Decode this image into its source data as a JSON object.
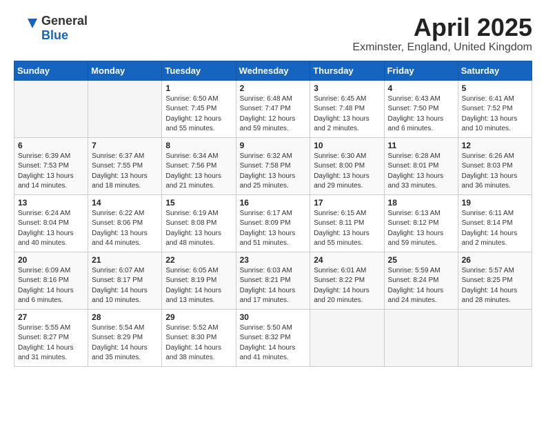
{
  "logo": {
    "general": "General",
    "blue": "Blue"
  },
  "title": "April 2025",
  "subtitle": "Exminster, England, United Kingdom",
  "days_of_week": [
    "Sunday",
    "Monday",
    "Tuesday",
    "Wednesday",
    "Thursday",
    "Friday",
    "Saturday"
  ],
  "weeks": [
    [
      {
        "day": "",
        "info": ""
      },
      {
        "day": "",
        "info": ""
      },
      {
        "day": "1",
        "info": "Sunrise: 6:50 AM\nSunset: 7:45 PM\nDaylight: 12 hours and 55 minutes."
      },
      {
        "day": "2",
        "info": "Sunrise: 6:48 AM\nSunset: 7:47 PM\nDaylight: 12 hours and 59 minutes."
      },
      {
        "day": "3",
        "info": "Sunrise: 6:45 AM\nSunset: 7:48 PM\nDaylight: 13 hours and 2 minutes."
      },
      {
        "day": "4",
        "info": "Sunrise: 6:43 AM\nSunset: 7:50 PM\nDaylight: 13 hours and 6 minutes."
      },
      {
        "day": "5",
        "info": "Sunrise: 6:41 AM\nSunset: 7:52 PM\nDaylight: 13 hours and 10 minutes."
      }
    ],
    [
      {
        "day": "6",
        "info": "Sunrise: 6:39 AM\nSunset: 7:53 PM\nDaylight: 13 hours and 14 minutes."
      },
      {
        "day": "7",
        "info": "Sunrise: 6:37 AM\nSunset: 7:55 PM\nDaylight: 13 hours and 18 minutes."
      },
      {
        "day": "8",
        "info": "Sunrise: 6:34 AM\nSunset: 7:56 PM\nDaylight: 13 hours and 21 minutes."
      },
      {
        "day": "9",
        "info": "Sunrise: 6:32 AM\nSunset: 7:58 PM\nDaylight: 13 hours and 25 minutes."
      },
      {
        "day": "10",
        "info": "Sunrise: 6:30 AM\nSunset: 8:00 PM\nDaylight: 13 hours and 29 minutes."
      },
      {
        "day": "11",
        "info": "Sunrise: 6:28 AM\nSunset: 8:01 PM\nDaylight: 13 hours and 33 minutes."
      },
      {
        "day": "12",
        "info": "Sunrise: 6:26 AM\nSunset: 8:03 PM\nDaylight: 13 hours and 36 minutes."
      }
    ],
    [
      {
        "day": "13",
        "info": "Sunrise: 6:24 AM\nSunset: 8:04 PM\nDaylight: 13 hours and 40 minutes."
      },
      {
        "day": "14",
        "info": "Sunrise: 6:22 AM\nSunset: 8:06 PM\nDaylight: 13 hours and 44 minutes."
      },
      {
        "day": "15",
        "info": "Sunrise: 6:19 AM\nSunset: 8:08 PM\nDaylight: 13 hours and 48 minutes."
      },
      {
        "day": "16",
        "info": "Sunrise: 6:17 AM\nSunset: 8:09 PM\nDaylight: 13 hours and 51 minutes."
      },
      {
        "day": "17",
        "info": "Sunrise: 6:15 AM\nSunset: 8:11 PM\nDaylight: 13 hours and 55 minutes."
      },
      {
        "day": "18",
        "info": "Sunrise: 6:13 AM\nSunset: 8:12 PM\nDaylight: 13 hours and 59 minutes."
      },
      {
        "day": "19",
        "info": "Sunrise: 6:11 AM\nSunset: 8:14 PM\nDaylight: 14 hours and 2 minutes."
      }
    ],
    [
      {
        "day": "20",
        "info": "Sunrise: 6:09 AM\nSunset: 8:16 PM\nDaylight: 14 hours and 6 minutes."
      },
      {
        "day": "21",
        "info": "Sunrise: 6:07 AM\nSunset: 8:17 PM\nDaylight: 14 hours and 10 minutes."
      },
      {
        "day": "22",
        "info": "Sunrise: 6:05 AM\nSunset: 8:19 PM\nDaylight: 14 hours and 13 minutes."
      },
      {
        "day": "23",
        "info": "Sunrise: 6:03 AM\nSunset: 8:21 PM\nDaylight: 14 hours and 17 minutes."
      },
      {
        "day": "24",
        "info": "Sunrise: 6:01 AM\nSunset: 8:22 PM\nDaylight: 14 hours and 20 minutes."
      },
      {
        "day": "25",
        "info": "Sunrise: 5:59 AM\nSunset: 8:24 PM\nDaylight: 14 hours and 24 minutes."
      },
      {
        "day": "26",
        "info": "Sunrise: 5:57 AM\nSunset: 8:25 PM\nDaylight: 14 hours and 28 minutes."
      }
    ],
    [
      {
        "day": "27",
        "info": "Sunrise: 5:55 AM\nSunset: 8:27 PM\nDaylight: 14 hours and 31 minutes."
      },
      {
        "day": "28",
        "info": "Sunrise: 5:54 AM\nSunset: 8:29 PM\nDaylight: 14 hours and 35 minutes."
      },
      {
        "day": "29",
        "info": "Sunrise: 5:52 AM\nSunset: 8:30 PM\nDaylight: 14 hours and 38 minutes."
      },
      {
        "day": "30",
        "info": "Sunrise: 5:50 AM\nSunset: 8:32 PM\nDaylight: 14 hours and 41 minutes."
      },
      {
        "day": "",
        "info": ""
      },
      {
        "day": "",
        "info": ""
      },
      {
        "day": "",
        "info": ""
      }
    ]
  ]
}
